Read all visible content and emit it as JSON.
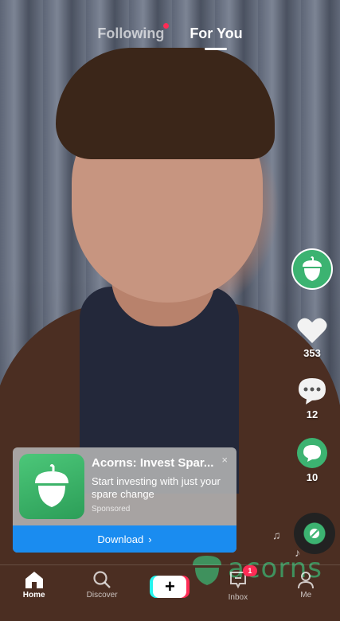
{
  "top_tabs": {
    "following": "Following",
    "for_you": "For You"
  },
  "rail": {
    "likes": "353",
    "comments": "12",
    "shares": "10"
  },
  "ad": {
    "title": "Acorns: Invest Spar...",
    "close": "×",
    "description": "Start investing with just your spare change",
    "sponsored": "Sponsored",
    "download": "Download",
    "download_chevron": "›"
  },
  "watermark": {
    "text": "acorns"
  },
  "bottom_nav": {
    "home": "Home",
    "discover": "Discover",
    "create": "+",
    "inbox": "Inbox",
    "inbox_badge": "1",
    "me": "Me"
  },
  "icons": [
    "acorn-icon",
    "heart-icon",
    "comment-icon",
    "share-icon",
    "music-note-icon",
    "home-icon",
    "search-icon",
    "inbox-icon",
    "profile-icon",
    "close-icon"
  ],
  "colors": {
    "accent_green": "#3cb371",
    "download_blue": "#1a8cf0",
    "badge_red": "#fe2c55",
    "tiktok_cyan": "#25f4ee"
  }
}
